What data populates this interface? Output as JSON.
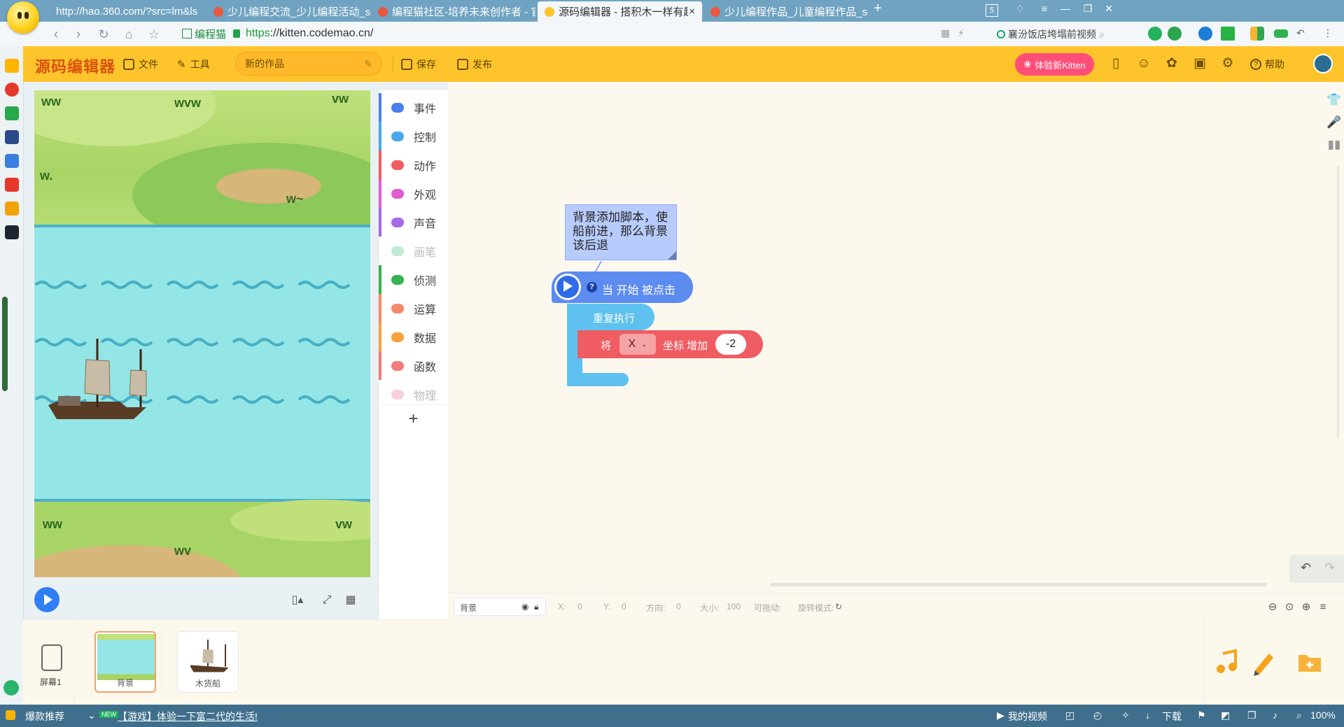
{
  "browser": {
    "tabs": [
      {
        "title": "http://hao.360.com/?src=lm&ls"
      },
      {
        "title": "少儿编程交流_少儿编程活动_scrat"
      },
      {
        "title": "编程猫社区-培养未来创作者 - 官方"
      },
      {
        "title": "源码编辑器 - 搭积木一样有趣的编"
      },
      {
        "title": "少儿编程作品_儿童编程作品_scrat"
      }
    ],
    "tab_count": "5",
    "new_tab": "+",
    "close_tab": "×",
    "site_label": "编程猫",
    "url_scheme": "https",
    "url_rest": "://kitten.codemao.cn/",
    "search_hint": "襄汾饭店垮塌前视频"
  },
  "editor": {
    "brand": "源码编辑器",
    "menu": {
      "file": "文件",
      "tools": "工具",
      "save": "保存",
      "publish": "发布",
      "help": "帮助"
    },
    "project_name": "新的作品",
    "try_new": "体验新Kitten"
  },
  "categories": [
    {
      "label": "事件",
      "color": "#4a7ff0",
      "disabled": false
    },
    {
      "label": "控制",
      "color": "#4aa8e8",
      "disabled": false
    },
    {
      "label": "动作",
      "color": "#ef5c62",
      "disabled": false
    },
    {
      "label": "外观",
      "color": "#e05cd3",
      "disabled": false
    },
    {
      "label": "声音",
      "color": "#a56ae6",
      "disabled": false
    },
    {
      "label": "画笔",
      "color": "#8ed7b0",
      "disabled": true
    },
    {
      "label": "侦测",
      "color": "#37b24d",
      "disabled": false
    },
    {
      "label": "运算",
      "color": "#f6896c",
      "disabled": false
    },
    {
      "label": "数据",
      "color": "#f7a23b",
      "disabled": false
    },
    {
      "label": "函数",
      "color": "#f27b7b",
      "disabled": false
    },
    {
      "label": "物理",
      "color": "#f2a9bd",
      "disabled": true
    }
  ],
  "categories_add": "+",
  "workspace": {
    "note_text": "背景添加脚本，使船前进，那么背景该后退",
    "hat_block": "当 开始 被点击",
    "help_mark": "?",
    "loop_block": "重复执行",
    "move_block": {
      "prefix": "将",
      "axis": "X",
      "suffix": "坐标 增加",
      "value": "-2"
    }
  },
  "properties": {
    "name": "背景",
    "x_label": "X:",
    "x": "0",
    "y_label": "Y:",
    "y": "0",
    "dir_label": "方向:",
    "dir": "0",
    "size_label": "大小:",
    "size": "100",
    "drag_label": "可拖动:",
    "rotate_label": "旋转模式:"
  },
  "sprites": {
    "screen_label": "屏幕1",
    "items": [
      {
        "name": "背景",
        "selected": true
      },
      {
        "name": "木货船",
        "selected": false
      }
    ]
  },
  "statusbar": {
    "left_label": "爆款推荐",
    "new_badge": "NEW",
    "news": "【游戏】体验一下富二代的生活!",
    "my_video": "我的视频",
    "download": "下载",
    "zoom": "100%"
  }
}
